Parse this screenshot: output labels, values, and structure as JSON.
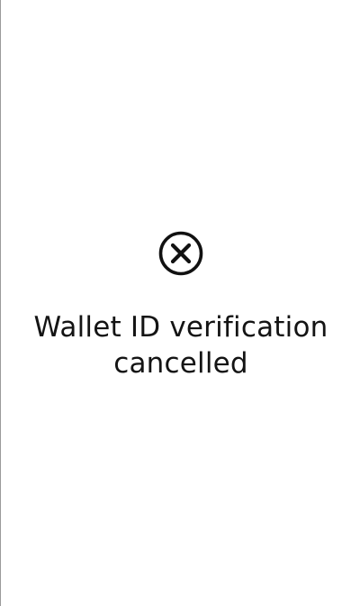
{
  "status": {
    "icon": "cancel-circle-icon",
    "message": "Wallet ID verification cancelled",
    "icon_color": "#111111",
    "text_color": "#141414"
  }
}
